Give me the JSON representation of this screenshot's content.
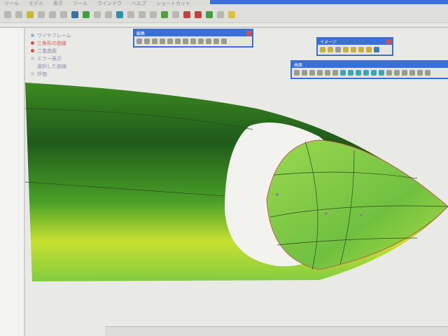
{
  "menu": [
    "ツール",
    "モデル",
    "表示",
    "ツール",
    "ウインドウ",
    "ヘルプ",
    "ショートカット"
  ],
  "tree": {
    "root": "ワイヤフレーム",
    "items": [
      {
        "label": "三角形の曲線",
        "color": "#d06060"
      },
      {
        "label": "二重曲面",
        "color": "#d06060"
      },
      {
        "label": "エラー表示",
        "color": "#aaaaaa"
      },
      {
        "label": "選択した曲線"
      },
      {
        "label": "評価"
      }
    ]
  },
  "toolbars": [
    {
      "title": "編集"
    },
    {
      "title": "イメージ"
    },
    {
      "title": "曲面"
    }
  ],
  "colors": {
    "accent": "#3a6fd8",
    "surface_dark": "#1f5a1a",
    "surface_light": "#7fd040",
    "surface_yellow": "#c8e030"
  }
}
